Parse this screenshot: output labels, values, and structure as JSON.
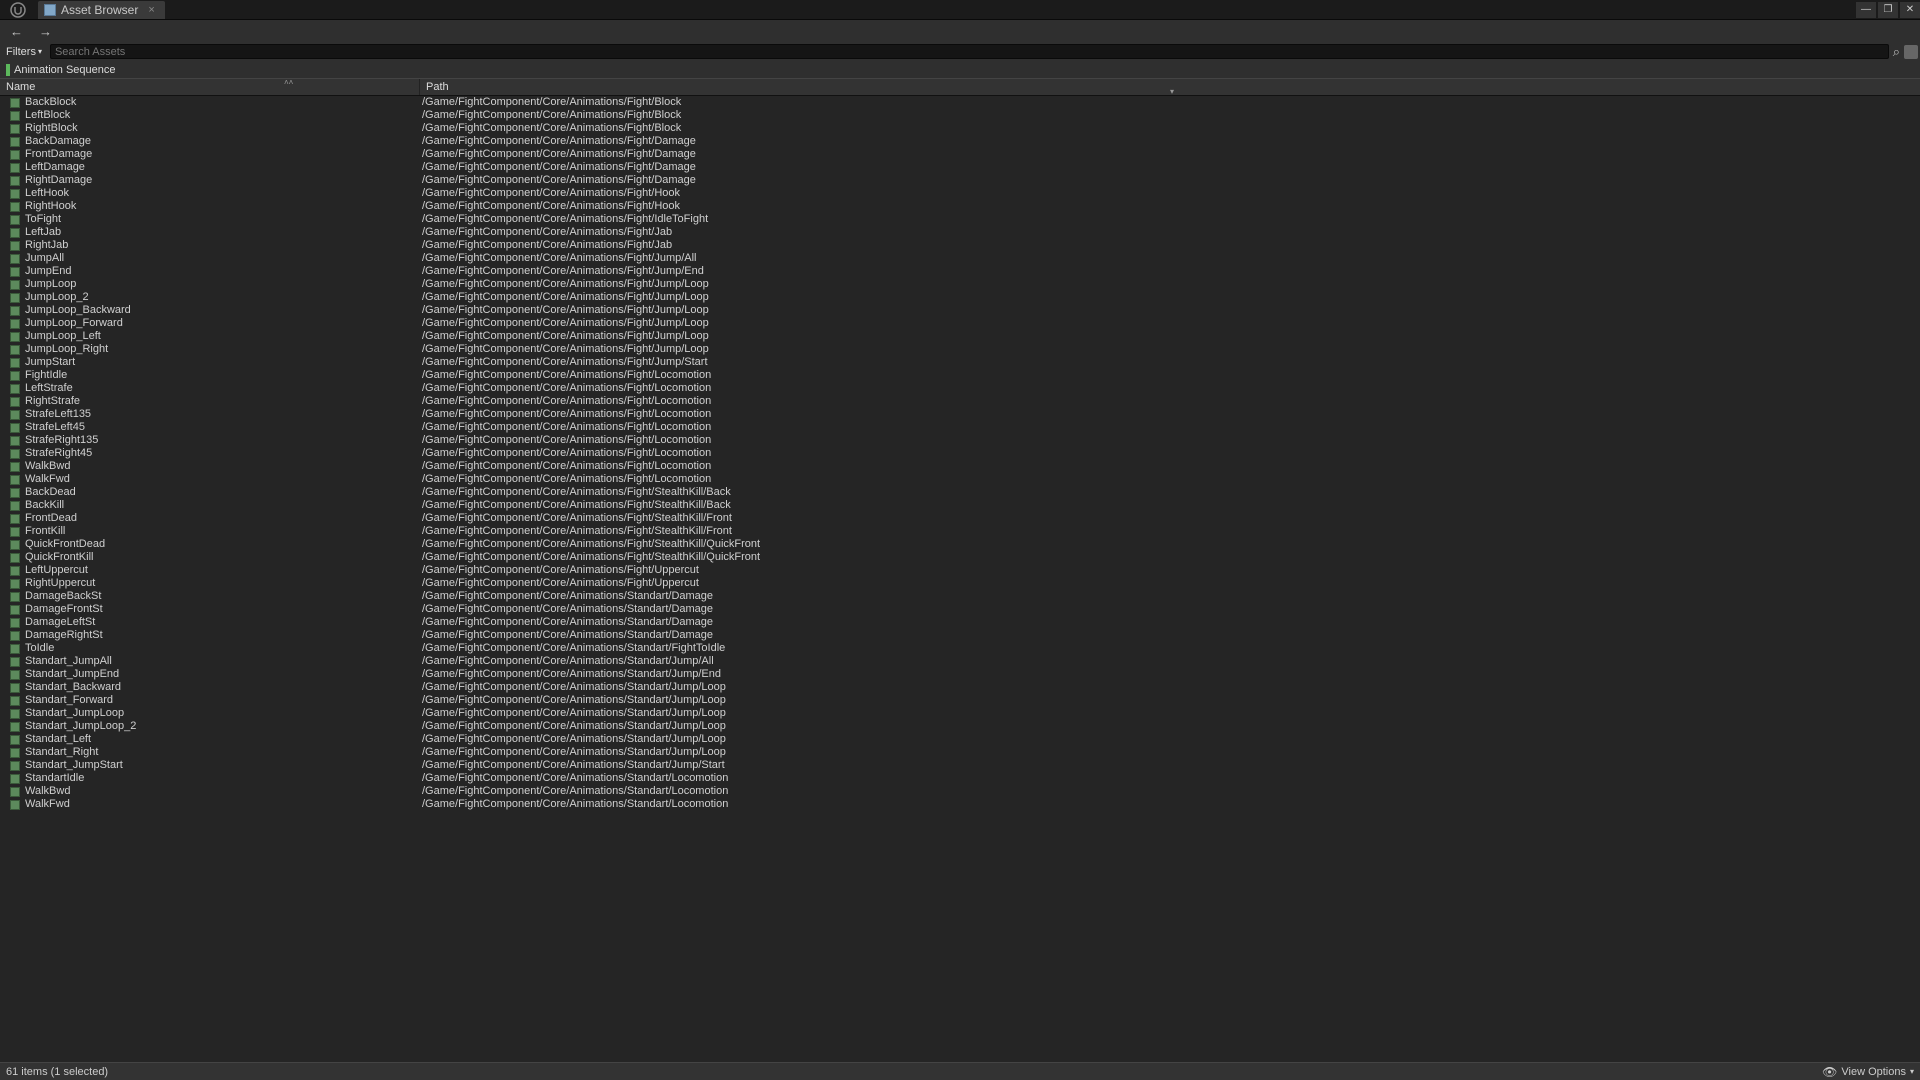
{
  "titlebar": {
    "logo_text": "U",
    "tab_label": "Asset Browser",
    "tab_close": "×",
    "minimize": "—",
    "maximize": "❐",
    "close": "✕"
  },
  "navbar": {
    "back": "←",
    "forward": "→"
  },
  "filterrow": {
    "filters_label": "Filters",
    "caret": "▾",
    "search_placeholder": "Search Assets",
    "search_glyph": "⌕"
  },
  "chip": {
    "label": "Animation Sequence"
  },
  "columns": {
    "name": "Name",
    "path": "Path",
    "sort_up": "˄˄",
    "sort_down": "▾"
  },
  "statusbar": {
    "text": "61 items (1 selected)",
    "view_options": "View Options",
    "eye": "👁",
    "caret": "▾"
  },
  "assets": [
    {
      "name": "BackBlock",
      "path": "/Game/FightComponent/Core/Animations/Fight/Block"
    },
    {
      "name": "LeftBlock",
      "path": "/Game/FightComponent/Core/Animations/Fight/Block"
    },
    {
      "name": "RightBlock",
      "path": "/Game/FightComponent/Core/Animations/Fight/Block"
    },
    {
      "name": "BackDamage",
      "path": "/Game/FightComponent/Core/Animations/Fight/Damage"
    },
    {
      "name": "FrontDamage",
      "path": "/Game/FightComponent/Core/Animations/Fight/Damage"
    },
    {
      "name": "LeftDamage",
      "path": "/Game/FightComponent/Core/Animations/Fight/Damage"
    },
    {
      "name": "RightDamage",
      "path": "/Game/FightComponent/Core/Animations/Fight/Damage"
    },
    {
      "name": "LeftHook",
      "path": "/Game/FightComponent/Core/Animations/Fight/Hook"
    },
    {
      "name": "RightHook",
      "path": "/Game/FightComponent/Core/Animations/Fight/Hook"
    },
    {
      "name": "ToFight",
      "path": "/Game/FightComponent/Core/Animations/Fight/IdleToFight"
    },
    {
      "name": "LeftJab",
      "path": "/Game/FightComponent/Core/Animations/Fight/Jab"
    },
    {
      "name": "RightJab",
      "path": "/Game/FightComponent/Core/Animations/Fight/Jab"
    },
    {
      "name": "JumpAll",
      "path": "/Game/FightComponent/Core/Animations/Fight/Jump/All"
    },
    {
      "name": "JumpEnd",
      "path": "/Game/FightComponent/Core/Animations/Fight/Jump/End"
    },
    {
      "name": "JumpLoop",
      "path": "/Game/FightComponent/Core/Animations/Fight/Jump/Loop"
    },
    {
      "name": "JumpLoop_2",
      "path": "/Game/FightComponent/Core/Animations/Fight/Jump/Loop"
    },
    {
      "name": "JumpLoop_Backward",
      "path": "/Game/FightComponent/Core/Animations/Fight/Jump/Loop"
    },
    {
      "name": "JumpLoop_Forward",
      "path": "/Game/FightComponent/Core/Animations/Fight/Jump/Loop"
    },
    {
      "name": "JumpLoop_Left",
      "path": "/Game/FightComponent/Core/Animations/Fight/Jump/Loop"
    },
    {
      "name": "JumpLoop_Right",
      "path": "/Game/FightComponent/Core/Animations/Fight/Jump/Loop"
    },
    {
      "name": "JumpStart",
      "path": "/Game/FightComponent/Core/Animations/Fight/Jump/Start"
    },
    {
      "name": "FightIdle",
      "path": "/Game/FightComponent/Core/Animations/Fight/Locomotion"
    },
    {
      "name": "LeftStrafe",
      "path": "/Game/FightComponent/Core/Animations/Fight/Locomotion"
    },
    {
      "name": "RightStrafe",
      "path": "/Game/FightComponent/Core/Animations/Fight/Locomotion"
    },
    {
      "name": "StrafeLeft135",
      "path": "/Game/FightComponent/Core/Animations/Fight/Locomotion"
    },
    {
      "name": "StrafeLeft45",
      "path": "/Game/FightComponent/Core/Animations/Fight/Locomotion"
    },
    {
      "name": "StrafeRight135",
      "path": "/Game/FightComponent/Core/Animations/Fight/Locomotion"
    },
    {
      "name": "StrafeRight45",
      "path": "/Game/FightComponent/Core/Animations/Fight/Locomotion"
    },
    {
      "name": "WalkBwd",
      "path": "/Game/FightComponent/Core/Animations/Fight/Locomotion"
    },
    {
      "name": "WalkFwd",
      "path": "/Game/FightComponent/Core/Animations/Fight/Locomotion"
    },
    {
      "name": "BackDead",
      "path": "/Game/FightComponent/Core/Animations/Fight/StealthKill/Back"
    },
    {
      "name": "BackKill",
      "path": "/Game/FightComponent/Core/Animations/Fight/StealthKill/Back"
    },
    {
      "name": "FrontDead",
      "path": "/Game/FightComponent/Core/Animations/Fight/StealthKill/Front"
    },
    {
      "name": "FrontKill",
      "path": "/Game/FightComponent/Core/Animations/Fight/StealthKill/Front"
    },
    {
      "name": "QuickFrontDead",
      "path": "/Game/FightComponent/Core/Animations/Fight/StealthKill/QuickFront"
    },
    {
      "name": "QuickFrontKill",
      "path": "/Game/FightComponent/Core/Animations/Fight/StealthKill/QuickFront"
    },
    {
      "name": "LeftUppercut",
      "path": "/Game/FightComponent/Core/Animations/Fight/Uppercut"
    },
    {
      "name": "RightUppercut",
      "path": "/Game/FightComponent/Core/Animations/Fight/Uppercut"
    },
    {
      "name": "DamageBackSt",
      "path": "/Game/FightComponent/Core/Animations/Standart/Damage"
    },
    {
      "name": "DamageFrontSt",
      "path": "/Game/FightComponent/Core/Animations/Standart/Damage"
    },
    {
      "name": "DamageLeftSt",
      "path": "/Game/FightComponent/Core/Animations/Standart/Damage"
    },
    {
      "name": "DamageRightSt",
      "path": "/Game/FightComponent/Core/Animations/Standart/Damage"
    },
    {
      "name": "ToIdle",
      "path": "/Game/FightComponent/Core/Animations/Standart/FightToIdle"
    },
    {
      "name": "Standart_JumpAll",
      "path": "/Game/FightComponent/Core/Animations/Standart/Jump/All"
    },
    {
      "name": "Standart_JumpEnd",
      "path": "/Game/FightComponent/Core/Animations/Standart/Jump/End"
    },
    {
      "name": "Standart_Backward",
      "path": "/Game/FightComponent/Core/Animations/Standart/Jump/Loop"
    },
    {
      "name": "Standart_Forward",
      "path": "/Game/FightComponent/Core/Animations/Standart/Jump/Loop"
    },
    {
      "name": "Standart_JumpLoop",
      "path": "/Game/FightComponent/Core/Animations/Standart/Jump/Loop"
    },
    {
      "name": "Standart_JumpLoop_2",
      "path": "/Game/FightComponent/Core/Animations/Standart/Jump/Loop"
    },
    {
      "name": "Standart_Left",
      "path": "/Game/FightComponent/Core/Animations/Standart/Jump/Loop"
    },
    {
      "name": "Standart_Right",
      "path": "/Game/FightComponent/Core/Animations/Standart/Jump/Loop"
    },
    {
      "name": "Standart_JumpStart",
      "path": "/Game/FightComponent/Core/Animations/Standart/Jump/Start"
    },
    {
      "name": "StandartIdle",
      "path": "/Game/FightComponent/Core/Animations/Standart/Locomotion"
    },
    {
      "name": "WalkBwd",
      "path": "/Game/FightComponent/Core/Animations/Standart/Locomotion"
    },
    {
      "name": "WalkFwd",
      "path": "/Game/FightComponent/Core/Animations/Standart/Locomotion"
    }
  ]
}
